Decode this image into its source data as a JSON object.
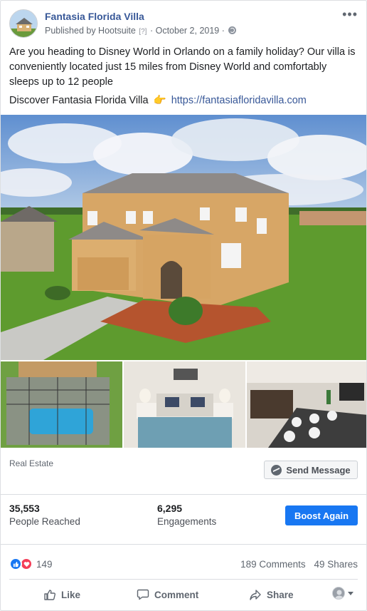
{
  "post": {
    "page_name": "Fantasia Florida Villa",
    "published_by": "Published by Hootsuite",
    "help_mark": "[?]",
    "separator": "·",
    "date": "October 2, 2019",
    "text": "Are you heading to Disney World in Orlando on a family holiday? Our villa is conveniently located just 15 miles from Disney World and comfortably sleeps up to 12 people",
    "discover_text": "Discover Fantasia Florida Villa",
    "pointing_emoji": "👉",
    "link": "https://fantasiafloridavilla.com"
  },
  "category": "Real Estate",
  "send_message_label": "Send Message",
  "stats": {
    "reached_value": "35,553",
    "reached_label": "People Reached",
    "engagements_value": "6,295",
    "engagements_label": "Engagements"
  },
  "boost_label": "Boost Again",
  "reactions": {
    "count": "149",
    "comments": "189 Comments",
    "shares": "49 Shares"
  },
  "actions": {
    "like": "Like",
    "comment": "Comment",
    "share": "Share"
  },
  "icons": [
    "more-icon",
    "globe-icon",
    "messenger-icon",
    "like-reaction-icon",
    "love-reaction-icon",
    "thumbs-up-icon",
    "comment-icon",
    "share-icon",
    "caret-down-icon"
  ],
  "colors": {
    "brand_blue": "#1877f2",
    "link_blue": "#385898",
    "love_red": "#f33e58"
  }
}
